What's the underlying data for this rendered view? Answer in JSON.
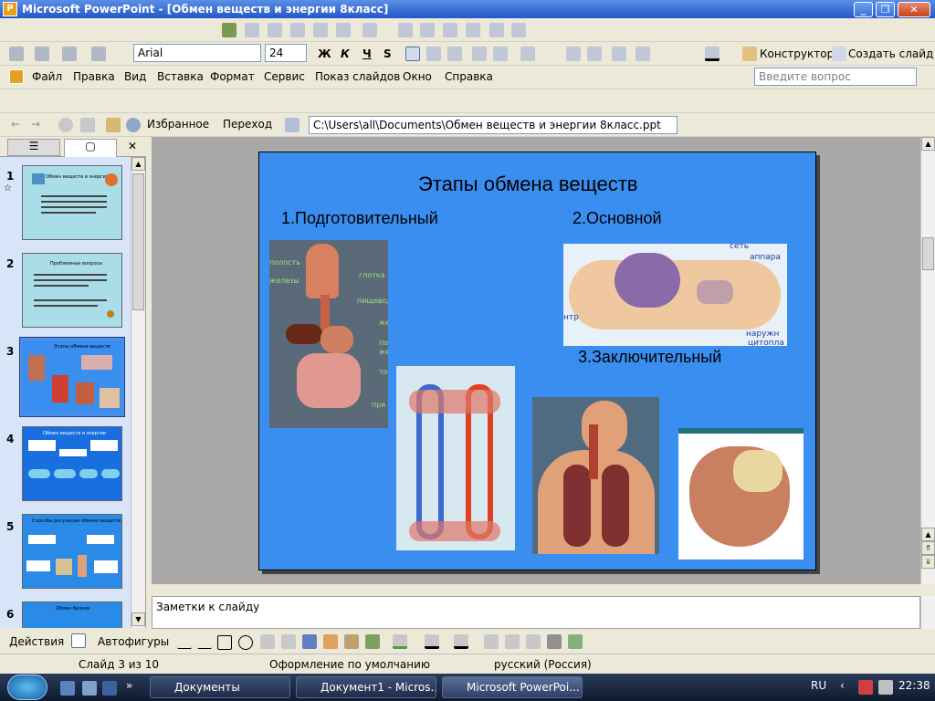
{
  "window": {
    "title": "Microsoft PowerPoint - [Обмен веществ и энергии 8класс]"
  },
  "formatting": {
    "font": "Arial",
    "size": "24",
    "bold": "Ж",
    "italic": "К",
    "underline": "Ч",
    "shadow": "S",
    "design_label": "Конструктор",
    "new_slide_label": "Создать слайд"
  },
  "menu": {
    "items": [
      "Файл",
      "Правка",
      "Вид",
      "Вставка",
      "Формат",
      "Сервис",
      "Показ слайдов",
      "Окно",
      "Справка"
    ],
    "help_placeholder": "Введите вопрос"
  },
  "web": {
    "favorites": "Избранное",
    "go": "Переход",
    "path": "C:\\Users\\all\\Documents\\Обмен веществ и энергии 8класс.ppt"
  },
  "thumbs": [
    {
      "num": "1",
      "title": "Обмен веществ и энергии",
      "color": "#a9dde8"
    },
    {
      "num": "2",
      "title": "Проблемные вопросы",
      "color": "#a9dde8"
    },
    {
      "num": "3",
      "title": "Этапы обмена веществ",
      "color": "#3a8ef0"
    },
    {
      "num": "4",
      "title": "Обмен веществ и энергии",
      "color": "#1a6fe0"
    },
    {
      "num": "5",
      "title": "Способы регуляции обмена веществ",
      "color": "#2a8ae8"
    },
    {
      "num": "6",
      "title": "Обмен белков",
      "color": "#2a8ae8"
    }
  ],
  "slide": {
    "title": "Этапы обмена веществ",
    "stage1": "1.Подготовительный",
    "stage2": "2.Основной",
    "stage3": "3.Заключительный",
    "labels_digestive": [
      "полость",
      "железы",
      "глотка",
      "пищевод",
      "жел",
      "по",
      "же",
      "то",
      "пря"
    ],
    "labels_cell": [
      "сеть",
      "аппара",
      "нтр",
      "наружн",
      "цитопла"
    ]
  },
  "notes": {
    "placeholder": "Заметки к слайду"
  },
  "drawing": {
    "actions": "Действия",
    "autoshapes": "Автофигуры"
  },
  "status": {
    "slide": "Слайд 3 из 10",
    "design": "Оформление по умолчанию",
    "lang": "русский (Россия)"
  },
  "taskbar": {
    "tasks": [
      "Документы",
      "Документ1 - Micros...",
      "Microsoft PowerPoi..."
    ],
    "lang": "RU",
    "time": "22:38"
  }
}
